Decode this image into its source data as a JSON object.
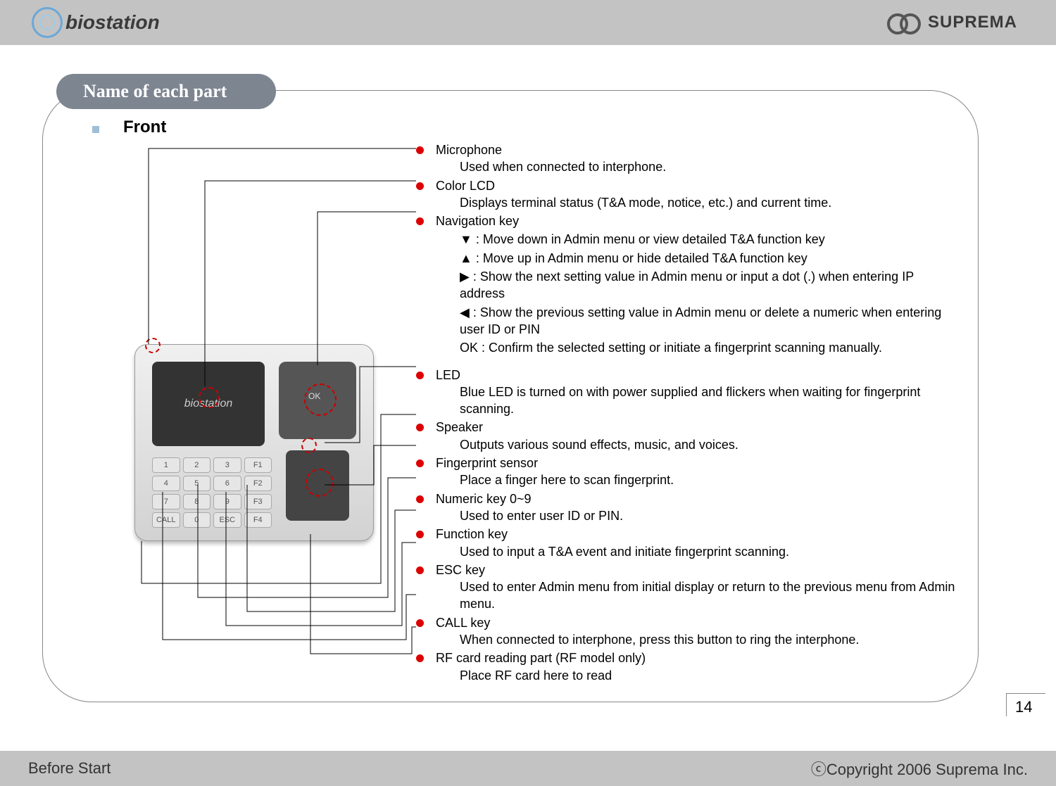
{
  "header": {
    "brand": "biostation",
    "vendor": "SUPREMA"
  },
  "title": "Name of each part",
  "subheading": "Front",
  "device_screen_text": "biostation",
  "keypad_labels": [
    "1",
    "2",
    "3",
    "F1",
    "4",
    "5",
    "6",
    "F2",
    "7",
    "8",
    "9",
    "F3",
    "CALL",
    "0",
    "ESC",
    "F4"
  ],
  "callouts": [
    {
      "label": "Microphone",
      "desc": [
        "Used when connected to interphone."
      ]
    },
    {
      "label": "Color LCD",
      "desc": [
        "Displays terminal status (T&A mode, notice, etc.) and current time."
      ]
    },
    {
      "label": "Navigation key",
      "desc": [
        "▼ : Move down in Admin menu or view detailed T&A function key",
        "▲ : Move up in Admin menu or hide detailed T&A function key",
        "▶ : Show the next setting value in Admin menu or input a dot (.) when entering IP address",
        "◀ : Show the previous setting value in Admin menu or delete a numeric when entering user ID or PIN",
        "OK : Confirm the selected setting or initiate a fingerprint scanning manually."
      ]
    },
    {
      "label": "LED",
      "desc": [
        "Blue LED is turned on with power supplied and flickers when waiting for fingerprint scanning."
      ]
    },
    {
      "label": "Speaker",
      "desc": [
        "Outputs various sound effects, music, and voices."
      ]
    },
    {
      "label": "Fingerprint sensor",
      "desc": [
        "Place a finger here to scan fingerprint."
      ]
    },
    {
      "label": "Numeric key 0~9",
      "desc": [
        "Used to enter user ID or PIN."
      ]
    },
    {
      "label": "Function key",
      "desc": [
        "Used to input a T&A event and initiate fingerprint scanning."
      ]
    },
    {
      "label": "ESC key",
      "desc": [
        "Used to enter Admin menu from initial display or return to the previous menu from Admin menu."
      ]
    },
    {
      "label": "CALL key",
      "desc": [
        "When connected to interphone, press this button to ring the interphone."
      ]
    },
    {
      "label": "RF card reading part (RF model only)",
      "desc": [
        "Place RF card here to read"
      ]
    }
  ],
  "page_number": "14",
  "footer": {
    "left": "Before Start",
    "right": "ⓒCopyright 2006 Suprema Inc."
  }
}
